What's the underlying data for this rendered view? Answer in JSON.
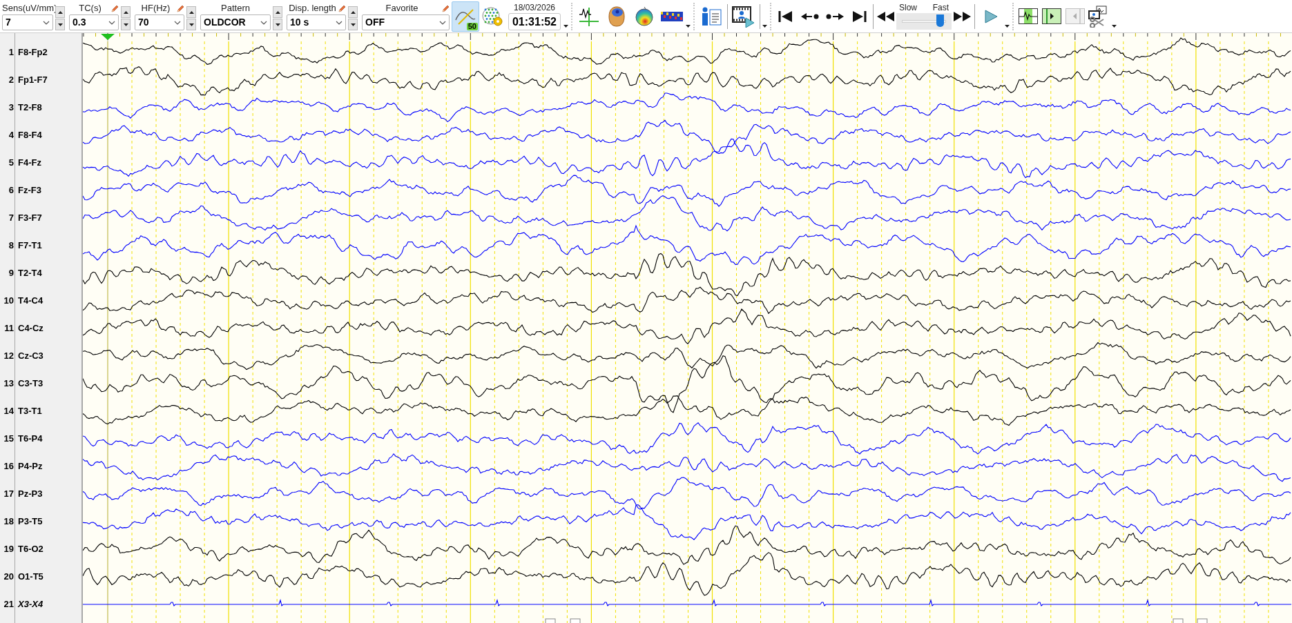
{
  "controls": [
    {
      "label": "Sens(uV/mm)",
      "value": "7",
      "editable": false,
      "spinner": true
    },
    {
      "label": "TC(s)",
      "value": "0.3",
      "editable": true,
      "spinner": true
    },
    {
      "label": "HF(Hz)",
      "value": "70",
      "editable": true,
      "spinner": true
    },
    {
      "label": "Pattern",
      "value": "OLDCOR",
      "editable": false,
      "spinner": true
    },
    {
      "label": "Disp. length",
      "value": "10 s",
      "editable": true,
      "spinner": true
    },
    {
      "label": "Favorite",
      "value": "OFF",
      "editable": true,
      "spinner": false
    }
  ],
  "filter_toggle": {
    "badge": "50",
    "selected": true
  },
  "recording_time": {
    "date": "18/03/2026",
    "time": "01:31:52"
  },
  "speed": {
    "slow_label": "Slow",
    "fast_label": "Fast",
    "level": 0.88
  },
  "marker_tools": [
    {
      "kind": "waveform",
      "disabled": false
    },
    {
      "kind": "forward",
      "disabled": false
    },
    {
      "kind": "back",
      "disabled": true
    }
  ],
  "channels": [
    {
      "number": "1",
      "name": "F8-Fp2",
      "color": "#000000",
      "kind": "eeg"
    },
    {
      "number": "2",
      "name": "Fp1-F7",
      "color": "#000000",
      "kind": "eeg"
    },
    {
      "number": "3",
      "name": "T2-F8",
      "color": "#0000ff",
      "kind": "eeg"
    },
    {
      "number": "4",
      "name": "F8-F4",
      "color": "#0000ff",
      "kind": "eeg"
    },
    {
      "number": "5",
      "name": "F4-Fz",
      "color": "#0000ff",
      "kind": "eeg"
    },
    {
      "number": "6",
      "name": "Fz-F3",
      "color": "#0000ff",
      "kind": "eeg"
    },
    {
      "number": "7",
      "name": "F3-F7",
      "color": "#0000ff",
      "kind": "eeg"
    },
    {
      "number": "8",
      "name": "F7-T1",
      "color": "#0000ff",
      "kind": "eeg"
    },
    {
      "number": "9",
      "name": "T2-T4",
      "color": "#000000",
      "kind": "eeg"
    },
    {
      "number": "10",
      "name": "T4-C4",
      "color": "#000000",
      "kind": "eeg"
    },
    {
      "number": "11",
      "name": "C4-Cz",
      "color": "#000000",
      "kind": "eeg"
    },
    {
      "number": "12",
      "name": "Cz-C3",
      "color": "#000000",
      "kind": "eeg"
    },
    {
      "number": "13",
      "name": "C3-T3",
      "color": "#000000",
      "kind": "eeg"
    },
    {
      "number": "14",
      "name": "T3-T1",
      "color": "#000000",
      "kind": "eeg"
    },
    {
      "number": "15",
      "name": "T6-P4",
      "color": "#0000ff",
      "kind": "eeg"
    },
    {
      "number": "16",
      "name": "P4-Pz",
      "color": "#0000ff",
      "kind": "eeg"
    },
    {
      "number": "17",
      "name": "Pz-P3",
      "color": "#0000ff",
      "kind": "eeg"
    },
    {
      "number": "18",
      "name": "P3-T5",
      "color": "#0000ff",
      "kind": "eeg"
    },
    {
      "number": "19",
      "name": "T6-O2",
      "color": "#000000",
      "kind": "eeg"
    },
    {
      "number": "20",
      "name": "O1-T5",
      "color": "#000000",
      "kind": "eeg"
    },
    {
      "number": "21",
      "name": "X3-X4",
      "color": "#0000ff",
      "kind": "auxiliary"
    }
  ]
}
